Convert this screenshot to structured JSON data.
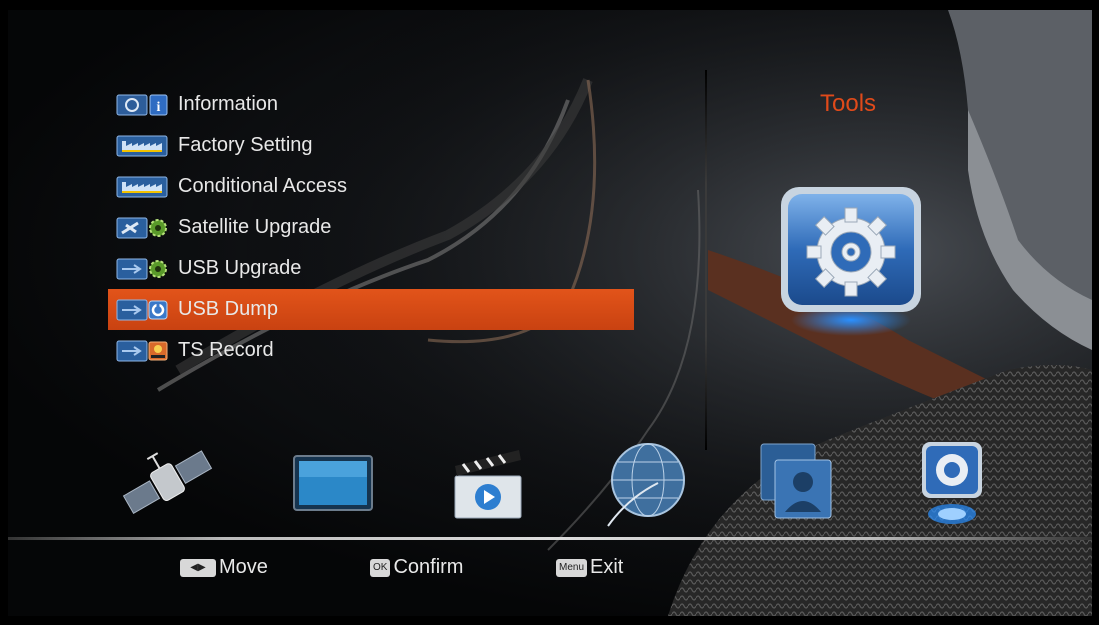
{
  "menu": {
    "items": [
      {
        "label": "Information",
        "icon": "info-icon"
      },
      {
        "label": "Factory Setting",
        "icon": "factory-icon"
      },
      {
        "label": "Conditional Access",
        "icon": "factory-icon"
      },
      {
        "label": "Satellite Upgrade",
        "icon": "satellite-gear-icon"
      },
      {
        "label": "USB Upgrade",
        "icon": "usb-gear-icon"
      },
      {
        "label": "USB Dump",
        "icon": "usb-dump-icon",
        "selected": true
      },
      {
        "label": "TS Record",
        "icon": "ts-record-icon"
      }
    ]
  },
  "panel": {
    "title": "Tools",
    "icon": "tools-gear-icon"
  },
  "icon_bar": [
    "satellite-icon",
    "tv-icon",
    "clapperboard-icon",
    "globe-icon",
    "photos-icon",
    "tools-icon"
  ],
  "footer": {
    "move_key": "◀▶",
    "move_label": "Move",
    "ok_key": "OK",
    "ok_label": "Confirm",
    "menu_key": "Menu",
    "menu_label": "Exit"
  },
  "colors": {
    "accent": "#e04a1a",
    "selected_bar": "#d44a16"
  }
}
